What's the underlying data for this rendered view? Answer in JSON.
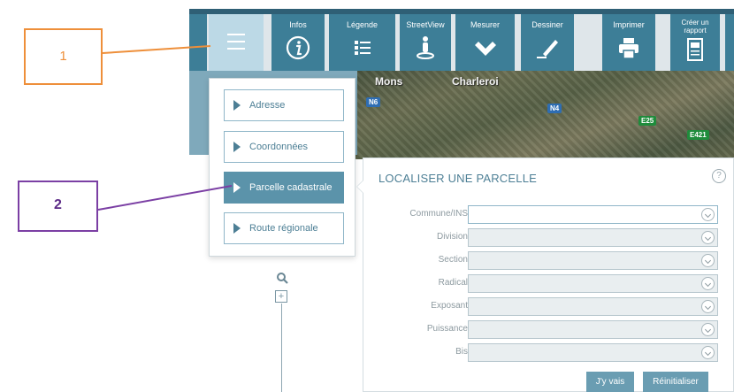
{
  "toolbar": {
    "buttons": [
      {
        "label": "Infos",
        "icon": "info-icon"
      },
      {
        "label": "Légende",
        "icon": "list-icon"
      },
      {
        "label": "StreetView",
        "icon": "streetview-icon"
      },
      {
        "label": "Mesurer",
        "icon": "ruler-icon"
      },
      {
        "label": "Dessiner",
        "icon": "pencil-icon"
      },
      {
        "label": "Imprimer",
        "icon": "printer-icon"
      },
      {
        "label": "Créer un rapport",
        "icon": "report-icon"
      }
    ],
    "menu_icon": "hamburger-icon"
  },
  "map": {
    "cities": [
      "Mons",
      "Charleroi"
    ],
    "roads": [
      "N6",
      "N4",
      "E25",
      "E421"
    ]
  },
  "dropdown": {
    "items": [
      {
        "label": "Adresse",
        "active": false
      },
      {
        "label": "Coordonnées",
        "active": false
      },
      {
        "label": "Parcelle cadastrale",
        "active": true
      },
      {
        "label": "Route régionale",
        "active": false
      }
    ]
  },
  "zoom": {
    "plus": "+"
  },
  "form": {
    "title": "LOCALISER UNE PARCELLE",
    "help": "?",
    "fields": [
      {
        "label": "Commune/INS",
        "value": "",
        "enabled": true
      },
      {
        "label": "Division",
        "value": "",
        "enabled": false
      },
      {
        "label": "Section",
        "value": "",
        "enabled": false
      },
      {
        "label": "Radical",
        "value": "",
        "enabled": false
      },
      {
        "label": "Exposant",
        "value": "",
        "enabled": false
      },
      {
        "label": "Puissance",
        "value": "",
        "enabled": false
      },
      {
        "label": "Bis",
        "value": "",
        "enabled": false
      }
    ],
    "submit_label": "J'y vais",
    "reset_label": "Réinitialiser"
  },
  "annotations": {
    "callout_1": "1",
    "callout_2": "2"
  },
  "colors": {
    "toolbar_button": "#3d7e97",
    "menu_active": "#bcd9e6",
    "item_active": "#5b93aa",
    "callout_1": "#ee8f3a",
    "callout_2": "#7b3fa4"
  }
}
